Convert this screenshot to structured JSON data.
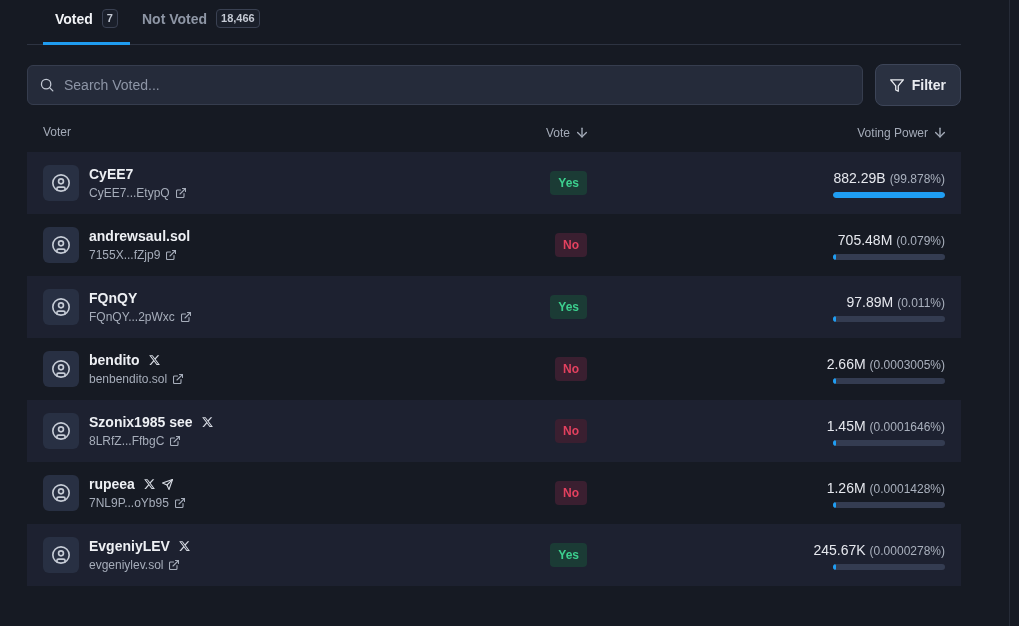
{
  "tabs": [
    {
      "label": "Voted",
      "count": "7",
      "selected": true
    },
    {
      "label": "Not Voted",
      "count": "18,466",
      "selected": false
    }
  ],
  "search": {
    "placeholder": "Search Voted..."
  },
  "filter_button": {
    "label": "Filter"
  },
  "table": {
    "columns": [
      {
        "label": "Voter",
        "sorted": false
      },
      {
        "label": "Vote",
        "sorted": true
      },
      {
        "label": "Voting Power",
        "sorted": true
      }
    ],
    "rows": [
      {
        "name": "CyEE7",
        "address": "CyEE7...EtypQ",
        "vote": {
          "label": "Yes",
          "kind": "yes"
        },
        "power": "882.29B",
        "share": "(99.878%)",
        "level": 0.99878
      },
      {
        "name": "andrewsaul.sol",
        "address": "7155X...fZjp9",
        "vote": {
          "label": "No",
          "kind": "no"
        },
        "power": "705.48M",
        "share": "(0.079%)",
        "level": 0.00079
      },
      {
        "name": "FQnQY",
        "address": "FQnQY...2pWxc",
        "vote": {
          "label": "Yes",
          "kind": "yes"
        },
        "power": "97.89M",
        "share": "(0.011%)",
        "level": 0.00011
      },
      {
        "name": "bendito",
        "socials": [
          {
            "kind": "x"
          }
        ],
        "address": "benbendito.sol",
        "vote": {
          "label": "No",
          "kind": "no"
        },
        "power": "2.66M",
        "share": "(0.0003005%)",
        "level": 3.005e-06
      },
      {
        "name": "Szonix1985 see",
        "socials": [
          {
            "kind": "x"
          }
        ],
        "address": "8LRfZ...FfbgC",
        "vote": {
          "label": "No",
          "kind": "no"
        },
        "power": "1.45M",
        "share": "(0.0001646%)",
        "level": 1.646e-06
      },
      {
        "name": "rupeea",
        "socials": [
          {
            "kind": "x"
          },
          {
            "kind": "telegram"
          }
        ],
        "address": "7NL9P...oYb95",
        "vote": {
          "label": "No",
          "kind": "no"
        },
        "power": "1.26M",
        "share": "(0.0001428%)",
        "level": 1.428e-06
      },
      {
        "name": "EvgeniyLEV",
        "socials": [
          {
            "kind": "x"
          }
        ],
        "address": "evgeniylev.sol",
        "vote": {
          "label": "Yes",
          "kind": "yes"
        },
        "power": "245.67K",
        "share": "(0.0000278%)",
        "level": 2.78e-07
      }
    ]
  }
}
